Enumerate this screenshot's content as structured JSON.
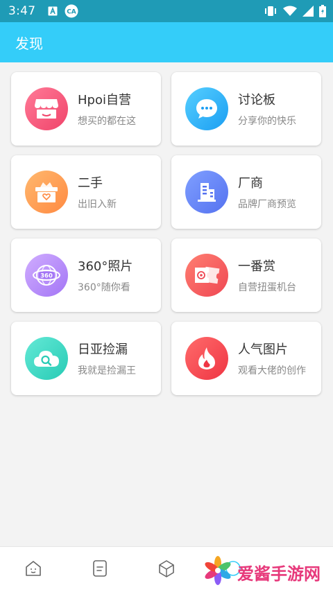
{
  "status_bar": {
    "time": "3:47",
    "left_icons": [
      "a-icon",
      "ca-icon"
    ],
    "right_icons": [
      "vibrate-icon",
      "wifi-icon",
      "signal-icon",
      "battery-icon"
    ]
  },
  "header": {
    "title": "发现"
  },
  "cards": [
    {
      "title": "Hpoi自营",
      "subtitle": "想买的都在这",
      "icon": "shop-icon",
      "color_from": "#ff6f90",
      "color_to": "#f24e6e"
    },
    {
      "title": "讨论板",
      "subtitle": "分享你的快乐",
      "icon": "chat-icon",
      "color_from": "#4cc6ff",
      "color_to": "#1fa4f3"
    },
    {
      "title": "二手",
      "subtitle": "出旧入新",
      "icon": "box-icon",
      "color_from": "#ffb066",
      "color_to": "#ff8f47"
    },
    {
      "title": "厂商",
      "subtitle": "品牌厂商预览",
      "icon": "building-icon",
      "color_from": "#7a9bff",
      "color_to": "#5877f2"
    },
    {
      "title": "360°照片",
      "subtitle": "360°随你看",
      "icon": "globe-360-icon",
      "color_from": "#c9a4ff",
      "color_to": "#a97af6"
    },
    {
      "title": "一番赏",
      "subtitle": "自营扭蛋机台",
      "icon": "ticket-icon",
      "color_from": "#ff7a6e",
      "color_to": "#f24c54"
    },
    {
      "title": "日亚捡漏",
      "subtitle": "我就是捡漏王",
      "icon": "cloud-search-icon",
      "color_from": "#5ee6d2",
      "color_to": "#2fd0bb"
    },
    {
      "title": "人气图片",
      "subtitle": "观看大佬的创作",
      "icon": "flame-icon",
      "color_from": "#ff6a6a",
      "color_to": "#f23d4a"
    }
  ],
  "bottom_nav": [
    {
      "icon": "home-icon"
    },
    {
      "icon": "notes-icon"
    },
    {
      "icon": "cube-icon"
    },
    {
      "icon": "discover-icon"
    }
  ],
  "watermark": {
    "text": "爱酱手游网"
  }
}
